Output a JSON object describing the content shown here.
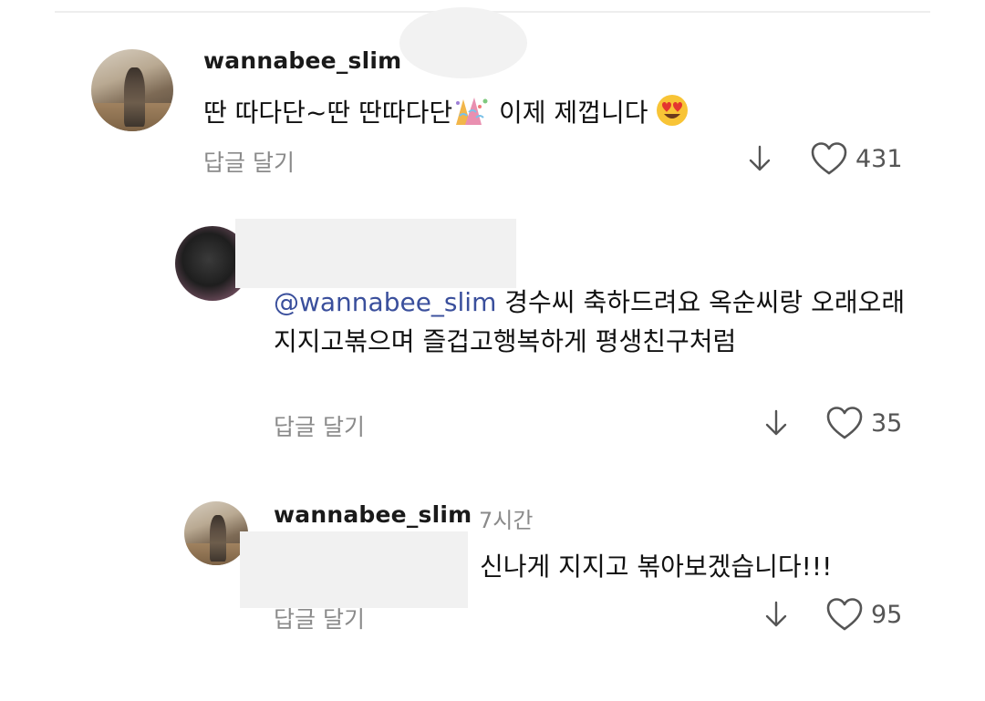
{
  "comments": [
    {
      "username": "wannabee_slim",
      "text_before_emoji": "딴 따다단~딴 딴따다단",
      "text_after_emoji": " 이제 제껍니다",
      "reply_label": "답글 달기",
      "likes": "431",
      "emoji_1": "confetti-emoji",
      "emoji_2": "heart-eyes-emoji"
    },
    {
      "mention": "@wannabee_slim",
      "text": " 경수씨 축하드려요 옥순씨랑 오래오래 지지고볶으며 즐겁고행복하게 평생친구처럼",
      "reply_label": "답글 달기",
      "likes": "35"
    },
    {
      "username": "wannabee_slim",
      "timestamp": "7시간",
      "text": "신나게 지지고 볶아보겠습니다!!!",
      "reply_label": "답글 달기",
      "likes": "95"
    }
  ],
  "icons": {
    "download": "download-arrow-icon",
    "like": "heart-outline-icon"
  },
  "colors": {
    "mention": "#3a4f9c",
    "muted_text": "#8a8a8a",
    "like_count": "#555555"
  }
}
